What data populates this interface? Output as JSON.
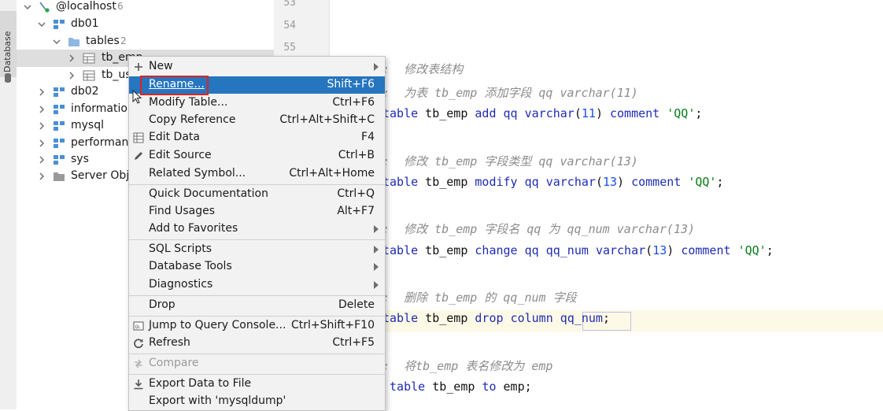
{
  "side_tab": {
    "label": "Database"
  },
  "tree": {
    "rows": [
      {
        "label": "@localhost",
        "count": "6"
      },
      {
        "label": "db01",
        "count": ""
      },
      {
        "label": "tables",
        "count": "2"
      },
      {
        "label": "tb_emp",
        "count": ""
      },
      {
        "label": "tb_us",
        "count": ""
      },
      {
        "label": "db02",
        "count": ""
      },
      {
        "label": "information",
        "count": ""
      },
      {
        "label": "mysql",
        "count": ""
      },
      {
        "label": "performanc",
        "count": ""
      },
      {
        "label": "sys",
        "count": ""
      },
      {
        "label": "Server Obje",
        "count": ""
      }
    ]
  },
  "gutter": {
    "lines": [
      "53",
      "54",
      "55"
    ]
  },
  "editor": {
    "lines": [
      {
        "tokens": [
          {
            "t": ":  修改表结构",
            "c": "comment"
          }
        ]
      },
      {
        "tokens": [
          {
            "t": ":  为表 tb_emp 添加字段 qq varchar(11)",
            "c": "comment"
          }
        ]
      },
      {
        "tokens": [
          {
            "t": "table",
            "c": "kw"
          },
          {
            "t": " tb_emp ",
            "c": "plain"
          },
          {
            "t": "add",
            "c": "kw"
          },
          {
            "t": " ",
            "c": "plain"
          },
          {
            "t": "qq",
            "c": "kw"
          },
          {
            "t": " ",
            "c": "plain"
          },
          {
            "t": "varchar",
            "c": "kw"
          },
          {
            "t": "(",
            "c": "plain"
          },
          {
            "t": "11",
            "c": "num"
          },
          {
            "t": ") ",
            "c": "plain"
          },
          {
            "t": "comment",
            "c": "kw"
          },
          {
            "t": " ",
            "c": "plain"
          },
          {
            "t": "'QQ'",
            "c": "str"
          },
          {
            "t": ";",
            "c": "plain"
          }
        ]
      },
      {
        "tokens": [
          {
            "t": ":  修改 tb_emp 字段类型 qq varchar(13)",
            "c": "comment"
          }
        ]
      },
      {
        "tokens": [
          {
            "t": "table",
            "c": "kw"
          },
          {
            "t": " tb_emp ",
            "c": "plain"
          },
          {
            "t": "modify",
            "c": "kw"
          },
          {
            "t": " ",
            "c": "plain"
          },
          {
            "t": "qq",
            "c": "kw"
          },
          {
            "t": " ",
            "c": "plain"
          },
          {
            "t": "varchar",
            "c": "kw"
          },
          {
            "t": "(",
            "c": "plain"
          },
          {
            "t": "13",
            "c": "num"
          },
          {
            "t": ") ",
            "c": "plain"
          },
          {
            "t": "comment",
            "c": "kw"
          },
          {
            "t": " ",
            "c": "plain"
          },
          {
            "t": "'QQ'",
            "c": "str"
          },
          {
            "t": ";",
            "c": "plain"
          }
        ]
      },
      {
        "tokens": [
          {
            "t": ":  修改 tb_emp 字段名 qq 为 qq_num varchar(13)",
            "c": "comment"
          }
        ]
      },
      {
        "tokens": [
          {
            "t": "table",
            "c": "kw"
          },
          {
            "t": " tb_emp ",
            "c": "plain"
          },
          {
            "t": "change",
            "c": "kw"
          },
          {
            "t": " ",
            "c": "plain"
          },
          {
            "t": "qq",
            "c": "kw"
          },
          {
            "t": " ",
            "c": "plain"
          },
          {
            "t": "qq_num",
            "c": "kw"
          },
          {
            "t": " ",
            "c": "plain"
          },
          {
            "t": "varchar",
            "c": "kw"
          },
          {
            "t": "(",
            "c": "plain"
          },
          {
            "t": "13",
            "c": "num"
          },
          {
            "t": ") ",
            "c": "plain"
          },
          {
            "t": "comment",
            "c": "kw"
          },
          {
            "t": " ",
            "c": "plain"
          },
          {
            "t": "'QQ'",
            "c": "str"
          },
          {
            "t": ";",
            "c": "plain"
          }
        ]
      },
      {
        "tokens": [
          {
            "t": ":  删除 tb_emp 的 qq_num 字段",
            "c": "comment"
          }
        ]
      },
      {
        "tokens": [
          {
            "t": "table",
            "c": "kw"
          },
          {
            "t": " tb_emp ",
            "c": "plain"
          },
          {
            "t": "drop",
            "c": "kw"
          },
          {
            "t": " ",
            "c": "plain"
          },
          {
            "t": "column",
            "c": "kw"
          },
          {
            "t": " ",
            "c": "plain"
          },
          {
            "t": "qq_num",
            "c": "kw"
          },
          {
            "t": ";",
            "c": "plain"
          }
        ]
      },
      {
        "tokens": [
          {
            "t": ":  将tb_emp 表名修改为 emp",
            "c": "comment"
          }
        ]
      },
      {
        "tokens": [
          {
            "t": " table",
            "c": "kw"
          },
          {
            "t": " tb_emp ",
            "c": "plain"
          },
          {
            "t": "to",
            "c": "kw"
          },
          {
            "t": " emp;",
            "c": "plain"
          }
        ]
      }
    ]
  },
  "menu": {
    "items": [
      {
        "label": "New",
        "shortcut": "",
        "icon": "plus-icon",
        "submenu": true
      },
      {
        "label": "Rename...",
        "shortcut": "Shift+F6",
        "active": true
      },
      {
        "label": "Modify Table...",
        "shortcut": "Ctrl+F6"
      },
      {
        "label": "Copy Reference",
        "shortcut": "Ctrl+Alt+Shift+C"
      },
      {
        "label": "Edit Data",
        "shortcut": "F4",
        "icon": "table-grid-icon"
      },
      {
        "label": "Edit Source",
        "shortcut": "Ctrl+B",
        "icon": "pencil-icon"
      },
      {
        "label": "Related Symbol...",
        "shortcut": "Ctrl+Alt+Home"
      },
      {
        "label": "Quick Documentation",
        "shortcut": "Ctrl+Q"
      },
      {
        "label": "Find Usages",
        "shortcut": "Alt+F7"
      },
      {
        "label": "Add to Favorites",
        "shortcut": "",
        "submenu": true
      },
      {
        "label": "SQL Scripts",
        "shortcut": "",
        "submenu": true
      },
      {
        "label": "Database Tools",
        "shortcut": "",
        "submenu": true
      },
      {
        "label": "Diagnostics",
        "shortcut": "",
        "submenu": true
      },
      {
        "label": "Drop",
        "shortcut": "Delete"
      },
      {
        "label": "Jump to Query Console...",
        "shortcut": "Ctrl+Shift+F10",
        "icon": "query-console-icon"
      },
      {
        "label": "Refresh",
        "shortcut": "Ctrl+F5",
        "icon": "refresh-icon"
      },
      {
        "label": "Compare",
        "shortcut": "",
        "icon": "compare-icon",
        "disabled": true
      },
      {
        "label": "Export Data to File",
        "shortcut": "",
        "icon": "download-icon"
      },
      {
        "label": "Export with 'mysqldump'",
        "shortcut": ""
      }
    ]
  }
}
